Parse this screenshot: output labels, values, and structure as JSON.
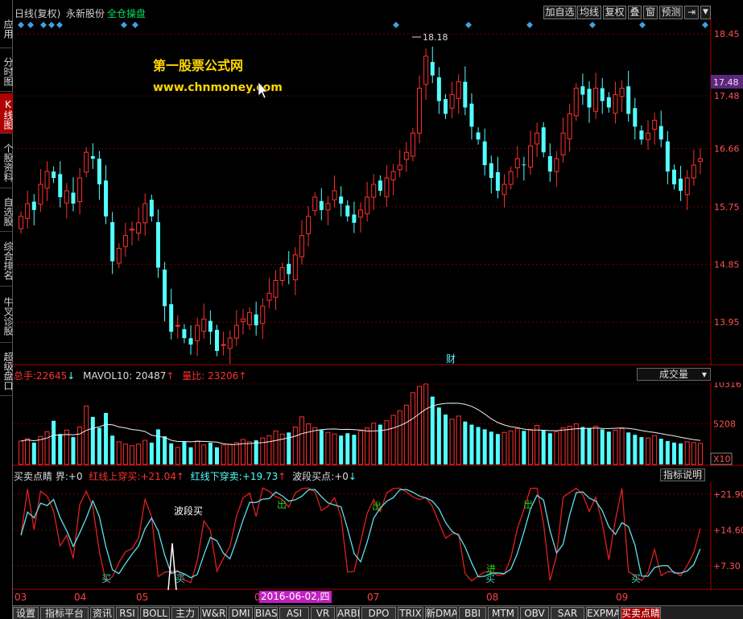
{
  "left_nav": [
    {
      "label": "应用"
    },
    {
      "label": "分时图"
    },
    {
      "label": "K线图"
    },
    {
      "label": "个股资料"
    },
    {
      "label": "自选股"
    },
    {
      "label": "综合排名"
    },
    {
      "label": "牛叉诊股"
    },
    {
      "label": "超级盘口"
    }
  ],
  "header": {
    "chart_mode": "日线(复权)",
    "stock_name": "永新股份",
    "tag": "全仓操盘",
    "buttons": [
      "加自选",
      "均线",
      "复权",
      "叠",
      "窗",
      "预测"
    ]
  },
  "watermark": {
    "line1": "第一股票公式网",
    "line2": "www.chnmoney.com"
  },
  "price_axis": [
    "18.45",
    "17.48",
    "16.66",
    "15.75",
    "14.85",
    "13.95"
  ],
  "price_marker": "17.48",
  "high_label": "18.18",
  "fin_label": "财",
  "volume_legend": {
    "total_label": "总手:",
    "total_value": "22645",
    "total_arrow": "↓",
    "mavol_label": "MAVOL10:",
    "mavol_value": "20487",
    "mavol_arrow": "↑",
    "ratio_label": "量比:",
    "ratio_value": "23206",
    "ratio_arrow": "↑"
  },
  "volume_dropdown": "成交量",
  "volume_axis": [
    "10316",
    "5208"
  ],
  "volume_unit": "X10",
  "indicator_legend": {
    "name": "买卖点睛",
    "boundary_label": "界:",
    "boundary_value": "+0",
    "red_label": "红线上穿买:",
    "red_value": "+21.04",
    "red_arrow": "↑",
    "cyan_label": "红线下穿卖:",
    "cyan_value": "+19.73",
    "cyan_arrow": "↑",
    "wave_label": "波段买点:",
    "wave_value": "+0",
    "wave_arrow": "↓"
  },
  "indicator_button": "指标说明",
  "indicator_axis": [
    "+21.90",
    "+14.60",
    "+7.30"
  ],
  "signals": {
    "wave_buy": "波段买",
    "buy": "买",
    "out": "出",
    "enter": "进"
  },
  "time_axis": [
    "03",
    "04",
    "05",
    "06",
    "07",
    "08",
    "09"
  ],
  "date_highlight": "2016-06-02,四",
  "bottom_tabs": [
    "设置",
    "指标平台",
    "资讯",
    "RSI",
    "BOLL",
    "主力",
    "W&R",
    "DMI",
    "BIAS",
    "ASI",
    "VR",
    "ARBR",
    "DPO",
    "TRIX",
    "新DMA",
    "BBI",
    "MTM",
    "OBV",
    "SAR",
    "EXPMA",
    "买卖点睛"
  ],
  "colors": {
    "up": "#ff3030",
    "down": "#54ffff",
    "accent": "#00e060",
    "signal": "#ffd700"
  },
  "chart_data": {
    "type": "candlestick",
    "ylim": [
      13.4,
      18.6
    ],
    "close": [
      15.6,
      15.8,
      15.7,
      16.1,
      16.3,
      16.2,
      15.9,
      16.0,
      15.8,
      16.2,
      16.6,
      16.5,
      16.1,
      15.6,
      14.9,
      15.1,
      15.3,
      15.4,
      15.5,
      15.8,
      15.6,
      14.8,
      14.2,
      13.8,
      13.9,
      13.7,
      13.6,
      13.9,
      14.0,
      13.8,
      13.5,
      13.6,
      13.7,
      13.9,
      14.0,
      14.1,
      13.9,
      14.2,
      14.4,
      14.6,
      14.8,
      14.7,
      15.0,
      15.3,
      15.6,
      15.9,
      15.7,
      15.8,
      16.0,
      15.8,
      15.6,
      15.5,
      15.7,
      15.9,
      16.1,
      16.0,
      16.2,
      16.3,
      16.4,
      16.6,
      16.9,
      17.6,
      18.1,
      17.8,
      17.4,
      17.2,
      17.5,
      17.7,
      17.3,
      17.0,
      16.8,
      16.4,
      16.2,
      16.0,
      16.1,
      16.3,
      16.5,
      16.4,
      16.7,
      16.9,
      16.6,
      16.3,
      16.5,
      16.9,
      17.2,
      17.6,
      17.5,
      17.3,
      17.6,
      17.4,
      17.3,
      17.5,
      17.6,
      17.2,
      17.0,
      16.8,
      16.9,
      17.1,
      16.8,
      16.3,
      16.1,
      16.0,
      16.2,
      16.4,
      16.5
    ],
    "volume": [
      3000,
      3300,
      2800,
      3600,
      4200,
      5600,
      3900,
      4400,
      3500,
      4800,
      7500,
      6100,
      4700,
      6600,
      3700,
      2900,
      2600,
      2400,
      2600,
      3100,
      2800,
      4500,
      3600,
      2700,
      2200,
      2900,
      2200,
      3000,
      2500,
      2800,
      2200,
      2500,
      2600,
      2800,
      3200,
      2900,
      3100,
      3400,
      3700,
      4300,
      3900,
      4100,
      4800,
      6100,
      5200,
      4700,
      4400,
      4100,
      3900,
      3700,
      4000,
      3800,
      4300,
      4700,
      5300,
      5100,
      5600,
      6300,
      6900,
      7600,
      9200,
      10000,
      10316,
      8700,
      7300,
      6400,
      5800,
      6200,
      5500,
      5100,
      4800,
      4500,
      4200,
      3900,
      4100,
      4300,
      4600,
      4300,
      4500,
      5000,
      4400,
      4000,
      4200,
      4700,
      4900,
      5200,
      4800,
      4600,
      4900,
      4500,
      4200,
      4400,
      4600,
      4100,
      3800,
      3500,
      3400,
      3700,
      3300,
      3000,
      2800,
      2700,
      2900,
      2800,
      2700
    ],
    "indicator": {
      "red_series": "mean-reverting oscillator (red)",
      "cyan_series": "mean-reverting oscillator (cyan)",
      "ylim": [
        3,
        24
      ]
    }
  }
}
